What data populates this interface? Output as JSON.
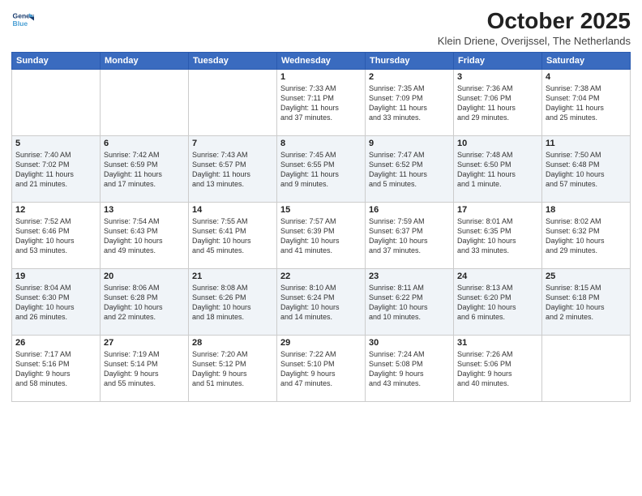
{
  "logo": {
    "line1": "General",
    "line2": "Blue"
  },
  "title": "October 2025",
  "subtitle": "Klein Driene, Overijssel, The Netherlands",
  "days_header": [
    "Sunday",
    "Monday",
    "Tuesday",
    "Wednesday",
    "Thursday",
    "Friday",
    "Saturday"
  ],
  "weeks": [
    [
      {
        "num": "",
        "info": ""
      },
      {
        "num": "",
        "info": ""
      },
      {
        "num": "",
        "info": ""
      },
      {
        "num": "1",
        "info": "Sunrise: 7:33 AM\nSunset: 7:11 PM\nDaylight: 11 hours\nand 37 minutes."
      },
      {
        "num": "2",
        "info": "Sunrise: 7:35 AM\nSunset: 7:09 PM\nDaylight: 11 hours\nand 33 minutes."
      },
      {
        "num": "3",
        "info": "Sunrise: 7:36 AM\nSunset: 7:06 PM\nDaylight: 11 hours\nand 29 minutes."
      },
      {
        "num": "4",
        "info": "Sunrise: 7:38 AM\nSunset: 7:04 PM\nDaylight: 11 hours\nand 25 minutes."
      }
    ],
    [
      {
        "num": "5",
        "info": "Sunrise: 7:40 AM\nSunset: 7:02 PM\nDaylight: 11 hours\nand 21 minutes."
      },
      {
        "num": "6",
        "info": "Sunrise: 7:42 AM\nSunset: 6:59 PM\nDaylight: 11 hours\nand 17 minutes."
      },
      {
        "num": "7",
        "info": "Sunrise: 7:43 AM\nSunset: 6:57 PM\nDaylight: 11 hours\nand 13 minutes."
      },
      {
        "num": "8",
        "info": "Sunrise: 7:45 AM\nSunset: 6:55 PM\nDaylight: 11 hours\nand 9 minutes."
      },
      {
        "num": "9",
        "info": "Sunrise: 7:47 AM\nSunset: 6:52 PM\nDaylight: 11 hours\nand 5 minutes."
      },
      {
        "num": "10",
        "info": "Sunrise: 7:48 AM\nSunset: 6:50 PM\nDaylight: 11 hours\nand 1 minute."
      },
      {
        "num": "11",
        "info": "Sunrise: 7:50 AM\nSunset: 6:48 PM\nDaylight: 10 hours\nand 57 minutes."
      }
    ],
    [
      {
        "num": "12",
        "info": "Sunrise: 7:52 AM\nSunset: 6:46 PM\nDaylight: 10 hours\nand 53 minutes."
      },
      {
        "num": "13",
        "info": "Sunrise: 7:54 AM\nSunset: 6:43 PM\nDaylight: 10 hours\nand 49 minutes."
      },
      {
        "num": "14",
        "info": "Sunrise: 7:55 AM\nSunset: 6:41 PM\nDaylight: 10 hours\nand 45 minutes."
      },
      {
        "num": "15",
        "info": "Sunrise: 7:57 AM\nSunset: 6:39 PM\nDaylight: 10 hours\nand 41 minutes."
      },
      {
        "num": "16",
        "info": "Sunrise: 7:59 AM\nSunset: 6:37 PM\nDaylight: 10 hours\nand 37 minutes."
      },
      {
        "num": "17",
        "info": "Sunrise: 8:01 AM\nSunset: 6:35 PM\nDaylight: 10 hours\nand 33 minutes."
      },
      {
        "num": "18",
        "info": "Sunrise: 8:02 AM\nSunset: 6:32 PM\nDaylight: 10 hours\nand 29 minutes."
      }
    ],
    [
      {
        "num": "19",
        "info": "Sunrise: 8:04 AM\nSunset: 6:30 PM\nDaylight: 10 hours\nand 26 minutes."
      },
      {
        "num": "20",
        "info": "Sunrise: 8:06 AM\nSunset: 6:28 PM\nDaylight: 10 hours\nand 22 minutes."
      },
      {
        "num": "21",
        "info": "Sunrise: 8:08 AM\nSunset: 6:26 PM\nDaylight: 10 hours\nand 18 minutes."
      },
      {
        "num": "22",
        "info": "Sunrise: 8:10 AM\nSunset: 6:24 PM\nDaylight: 10 hours\nand 14 minutes."
      },
      {
        "num": "23",
        "info": "Sunrise: 8:11 AM\nSunset: 6:22 PM\nDaylight: 10 hours\nand 10 minutes."
      },
      {
        "num": "24",
        "info": "Sunrise: 8:13 AM\nSunset: 6:20 PM\nDaylight: 10 hours\nand 6 minutes."
      },
      {
        "num": "25",
        "info": "Sunrise: 8:15 AM\nSunset: 6:18 PM\nDaylight: 10 hours\nand 2 minutes."
      }
    ],
    [
      {
        "num": "26",
        "info": "Sunrise: 7:17 AM\nSunset: 5:16 PM\nDaylight: 9 hours\nand 58 minutes."
      },
      {
        "num": "27",
        "info": "Sunrise: 7:19 AM\nSunset: 5:14 PM\nDaylight: 9 hours\nand 55 minutes."
      },
      {
        "num": "28",
        "info": "Sunrise: 7:20 AM\nSunset: 5:12 PM\nDaylight: 9 hours\nand 51 minutes."
      },
      {
        "num": "29",
        "info": "Sunrise: 7:22 AM\nSunset: 5:10 PM\nDaylight: 9 hours\nand 47 minutes."
      },
      {
        "num": "30",
        "info": "Sunrise: 7:24 AM\nSunset: 5:08 PM\nDaylight: 9 hours\nand 43 minutes."
      },
      {
        "num": "31",
        "info": "Sunrise: 7:26 AM\nSunset: 5:06 PM\nDaylight: 9 hours\nand 40 minutes."
      },
      {
        "num": "",
        "info": ""
      }
    ]
  ]
}
